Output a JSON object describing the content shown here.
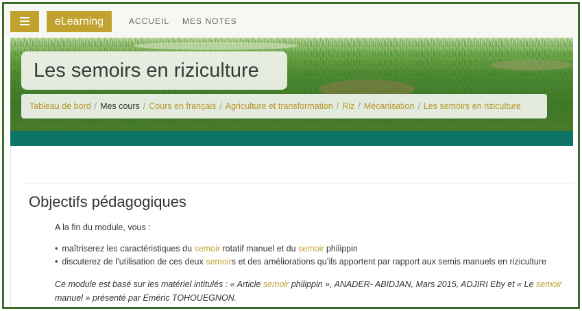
{
  "header": {
    "brand": "eLearning",
    "nav": [
      "ACCUEIL",
      "MES NOTES"
    ]
  },
  "page": {
    "title": "Les semoirs en riziculture"
  },
  "breadcrumb": [
    "Tableau de bord",
    "Mes cours",
    "Cours en français",
    "Agriculture et transformation",
    "Riz",
    "Mécanisation",
    "Les semoirs en riziculture"
  ],
  "content": {
    "heading": "Objectifs pédagogiques",
    "intro": "A la fin du module, vous :",
    "bullet1": {
      "a": "maîtriserez les caractéristiques du ",
      "b": "semoir",
      "c": " rotatif manuel et du ",
      "d": "semoir ",
      "e": "philippin"
    },
    "bullet2": {
      "a": "discuterez de l’utilisation de ces deux ",
      "b": "semoir",
      "c": "s et des améliorations qu’ils apportent par rapport aux semis manuels en riziculture"
    },
    "note": {
      "a": "Ce module est basé sur les matériel intitulés : « Article ",
      "b": "semoir",
      "c": " philippin », ANADER- ABIDJAN, Mars 2015, ADJIRI Eby et « Le ",
      "d": "semoir",
      "e": " manuel » présenté par  Eméric TOHOUEGNON."
    }
  },
  "colors": {
    "accent": "#c2a22e",
    "teal": "#0e7465",
    "frame": "#3d6b28"
  },
  "icons": {
    "menu": "hamburger-icon"
  }
}
